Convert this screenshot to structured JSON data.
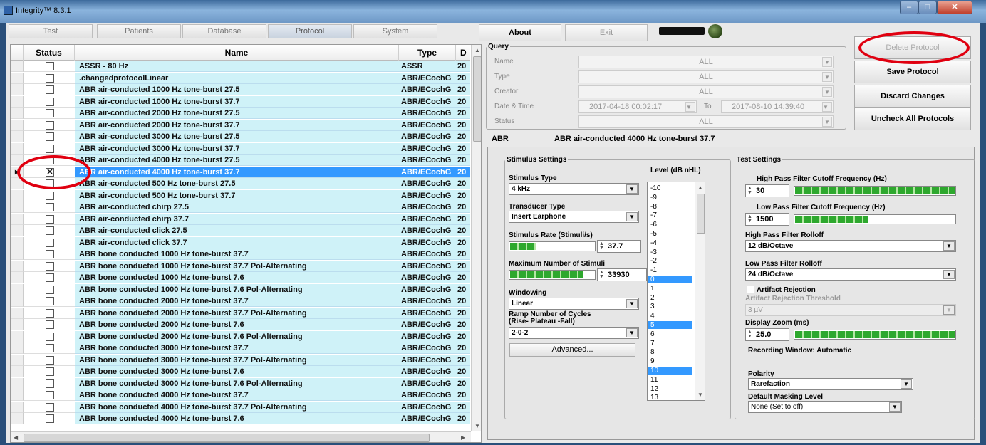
{
  "window": {
    "title": "Integrity™ 8.3.1",
    "minimize": "–",
    "maximize": "□",
    "close": "✕"
  },
  "tabs": [
    "Test",
    "Patients",
    "Database",
    "Protocol",
    "System"
  ],
  "active_tab": "Protocol",
  "toolbar": {
    "about": "About",
    "exit": "Exit"
  },
  "grid": {
    "headers": {
      "status": "Status",
      "name": "Name",
      "type": "Type",
      "date_partial": "D"
    },
    "rows": [
      {
        "name": "ASSR - 80 Hz",
        "type": "ASSR",
        "d": "20",
        "checked": false
      },
      {
        "name": ".changedprotocolLinear",
        "type": "ABR/ECochG",
        "d": "20",
        "checked": false
      },
      {
        "name": "ABR air-conducted 1000 Hz tone-burst 27.5",
        "type": "ABR/ECochG",
        "d": "20",
        "checked": false
      },
      {
        "name": "ABR air-conducted 1000 Hz tone-burst 37.7",
        "type": "ABR/ECochG",
        "d": "20",
        "checked": false
      },
      {
        "name": "ABR air-conducted 2000 Hz tone-burst 27.5",
        "type": "ABR/ECochG",
        "d": "20",
        "checked": false
      },
      {
        "name": "ABR air-conducted 2000 Hz tone-burst 37.7",
        "type": "ABR/ECochG",
        "d": "20",
        "checked": false
      },
      {
        "name": "ABR air-conducted 3000 Hz tone-burst 27.5",
        "type": "ABR/ECochG",
        "d": "20",
        "checked": false
      },
      {
        "name": "ABR air-conducted 3000 Hz tone-burst 37.7",
        "type": "ABR/ECochG",
        "d": "20",
        "checked": false
      },
      {
        "name": "ABR air-conducted 4000 Hz tone-burst 27.5",
        "type": "ABR/ECochG",
        "d": "20",
        "checked": false
      },
      {
        "name": "ABR air-conducted 4000 Hz tone-burst 37.7",
        "type": "ABR/ECochG",
        "d": "20",
        "checked": true,
        "selected": true
      },
      {
        "name": "ABR air-conducted 500 Hz tone-burst 27.5",
        "type": "ABR/ECochG",
        "d": "20",
        "checked": false
      },
      {
        "name": "ABR air-conducted 500 Hz tone-burst 37.7",
        "type": "ABR/ECochG",
        "d": "20",
        "checked": false
      },
      {
        "name": "ABR air-conducted chirp 27.5",
        "type": "ABR/ECochG",
        "d": "20",
        "checked": false
      },
      {
        "name": "ABR air-conducted chirp 37.7",
        "type": "ABR/ECochG",
        "d": "20",
        "checked": false
      },
      {
        "name": "ABR air-conducted click 27.5",
        "type": "ABR/ECochG",
        "d": "20",
        "checked": false
      },
      {
        "name": "ABR air-conducted click 37.7",
        "type": "ABR/ECochG",
        "d": "20",
        "checked": false
      },
      {
        "name": "ABR bone conducted 1000 Hz tone-burst 37.7",
        "type": "ABR/ECochG",
        "d": "20",
        "checked": false
      },
      {
        "name": "ABR bone conducted 1000 Hz tone-burst 37.7 Pol-Alternating",
        "type": "ABR/ECochG",
        "d": "20",
        "checked": false
      },
      {
        "name": "ABR bone conducted 1000 Hz tone-burst 7.6",
        "type": "ABR/ECochG",
        "d": "20",
        "checked": false
      },
      {
        "name": "ABR bone conducted 1000 Hz tone-burst 7.6 Pol-Alternating",
        "type": "ABR/ECochG",
        "d": "20",
        "checked": false
      },
      {
        "name": "ABR bone conducted 2000 Hz tone-burst 37.7",
        "type": "ABR/ECochG",
        "d": "20",
        "checked": false
      },
      {
        "name": "ABR bone conducted 2000 Hz tone-burst 37.7 Pol-Alternating",
        "type": "ABR/ECochG",
        "d": "20",
        "checked": false
      },
      {
        "name": "ABR bone conducted 2000 Hz tone-burst 7.6",
        "type": "ABR/ECochG",
        "d": "20",
        "checked": false
      },
      {
        "name": "ABR bone conducted 2000 Hz tone-burst 7.6 Pol-Alternating",
        "type": "ABR/ECochG",
        "d": "20",
        "checked": false
      },
      {
        "name": "ABR bone conducted 3000 Hz tone-burst 37.7",
        "type": "ABR/ECochG",
        "d": "20",
        "checked": false
      },
      {
        "name": "ABR bone conducted 3000 Hz tone-burst 37.7 Pol-Alternating",
        "type": "ABR/ECochG",
        "d": "20",
        "checked": false
      },
      {
        "name": "ABR bone conducted 3000 Hz tone-burst 7.6",
        "type": "ABR/ECochG",
        "d": "20",
        "checked": false
      },
      {
        "name": "ABR bone conducted 3000 Hz tone-burst 7.6 Pol-Alternating",
        "type": "ABR/ECochG",
        "d": "20",
        "checked": false
      },
      {
        "name": "ABR bone conducted 4000 Hz tone-burst 37.7",
        "type": "ABR/ECochG",
        "d": "20",
        "checked": false
      },
      {
        "name": "ABR bone conducted 4000 Hz tone-burst 37.7 Pol-Alternating",
        "type": "ABR/ECochG",
        "d": "20",
        "checked": false
      },
      {
        "name": "ABR bone conducted 4000 Hz tone-burst 7.6",
        "type": "ABR/ECochG",
        "d": "20",
        "checked": false
      }
    ]
  },
  "query": {
    "legend": "Query",
    "name_label": "Name",
    "name_value": "ALL",
    "type_label": "Type",
    "type_value": "ALL",
    "creator_label": "Creator",
    "creator_value": "ALL",
    "datetime_label": "Date & Time",
    "date_from": "2017-04-18 00:02:17",
    "to_label": "To",
    "date_to": "2017-08-10 14:39:40",
    "status_label": "Status",
    "status_value": "ALL"
  },
  "actions": {
    "delete": "Delete Protocol",
    "save": "Save Protocol",
    "discard": "Discard Changes",
    "uncheck": "Uncheck All Protocols"
  },
  "protocol_header": {
    "type": "ABR",
    "name": "ABR air-conducted 4000 Hz tone-burst 37.7"
  },
  "stimulus": {
    "legend": "Stimulus Settings",
    "type_label": "Stimulus Type",
    "type_value": "4 kHz",
    "transducer_label": "Transducer Type",
    "transducer_value": "Insert Earphone",
    "rate_label": "Stimulus Rate (Stimuli/s)",
    "rate_value": "37.7",
    "rate_fill": 0.3,
    "max_label": "Maximum Number of Stimuli",
    "max_value": "33930",
    "max_fill": 0.85,
    "windowing_label": "Windowing",
    "windowing_value": "Linear",
    "ramp_label": "Ramp Number of Cycles",
    "ramp_sub": "(Rise- Plateau -Fall)",
    "ramp_value": "2-0-2",
    "advanced": "Advanced..."
  },
  "level": {
    "label": "Level (dB nHL)",
    "items": [
      "-10",
      "-9",
      "-8",
      "-7",
      "-6",
      "-5",
      "-4",
      "-3",
      "-2",
      "-1",
      "0",
      "1",
      "2",
      "3",
      "4",
      "5",
      "6",
      "7",
      "8",
      "9",
      "10",
      "11",
      "12",
      "13"
    ],
    "selected": [
      "0",
      "5",
      "10"
    ]
  },
  "test_settings": {
    "legend": "Test Settings",
    "hpf_label": "High Pass Filter Cutoff Frequency (Hz)",
    "hpf_value": "30",
    "hpf_fill": 1.0,
    "lpf_label": "Low Pass Filter Cutoff Frequency (Hz)",
    "lpf_value": "1500",
    "lpf_fill": 0.45,
    "hp_rolloff_label": "High Pass Filter Rolloff",
    "hp_rolloff_value": "12 dB/Octave",
    "lp_rolloff_label": "Low Pass Filter Rolloff",
    "lp_rolloff_value": "24 dB/Octave",
    "artifact_label": "Artifact Rejection",
    "artifact_threshold_label": "Artifact Rejection Threshold",
    "artifact_threshold_value": "3 µV",
    "zoom_label": "Display Zoom (ms)",
    "zoom_value": "25.0",
    "zoom_fill": 1.0,
    "recording_window": "Recording Window: Automatic",
    "polarity_label": "Polarity",
    "polarity_value": "Rarefaction",
    "masking_label": "Default Masking Level",
    "masking_value": "None (Set to off)"
  },
  "highlight_color": "#3399ff",
  "annotation_color": "#e00010"
}
